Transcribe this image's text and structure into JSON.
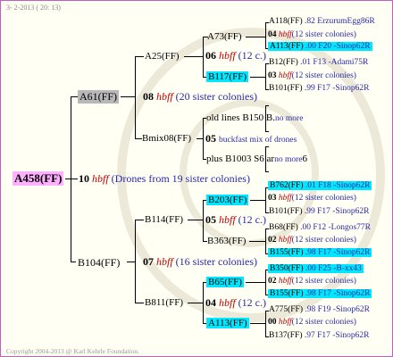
{
  "header": "3- 2-2013 ( 20: 13)",
  "footer": "Copyright 2004-2013 @ Karl Kehrle Foundation.",
  "root": {
    "name": "A458(FF)"
  },
  "gen1": [
    {
      "name": "A61(FF)",
      "num": "08",
      "hbff": "hbff",
      "note": "(20 sister colonies)"
    },
    {
      "num": "10",
      "hbff": "hbff",
      "note": "(Drones from 19 sister colonies)"
    },
    {
      "name": "B104(FF)",
      "num": "07",
      "hbff": "hbff",
      "note": "(16 sister colonies)"
    }
  ],
  "gen2": [
    {
      "name": "A25(FF)",
      "num": "06",
      "hbff": "hbff",
      "note": "(12 c.)"
    },
    {
      "name": "Bmix08(FF)",
      "num": "05",
      "note": "buckfast mix of drones"
    },
    {
      "name": "B114(FF)",
      "num": "05",
      "hbff": "hbff",
      "note": "(12 c.)"
    },
    {
      "name": "B811(FF)",
      "num": "04",
      "hbff": "hbff",
      "note": "(12 c.)"
    }
  ],
  "gen3": [
    {
      "name": "A73(FF)"
    },
    {
      "name": "B117(FF)"
    },
    {
      "name": "old lines B150 B.",
      "note": "no more"
    },
    {
      "name": "plus B1003 S6 ar",
      "note": "no more",
      "tail": "6"
    },
    {
      "name": "B203(FF)"
    },
    {
      "name": "B363(FF)"
    },
    {
      "name": "B65(FF)"
    },
    {
      "name": "A113(FF)"
    }
  ],
  "gen4": [
    {
      "name": "A118(FF)",
      "val": ".82",
      "note": "ErzurumEgg86R"
    },
    {
      "num": "04",
      "hbff": "hbff",
      "note": "(12 sister colonies)"
    },
    {
      "name": "A113(FF)",
      "val": ".00",
      "note": "F20 -Sinop62R"
    },
    {
      "name": "B12(FF)",
      "val": ".01",
      "note": "F13 -Adami75R"
    },
    {
      "num": "03",
      "hbff": "hbff",
      "note": "(12 sister colonies)"
    },
    {
      "name": "B101(FF)",
      "val": ".99",
      "note": "F17 -Sinop62R"
    },
    {
      "name": "B762(FF)",
      "val": ".01",
      "note": "F18 -Sinop62R"
    },
    {
      "num": "03",
      "hbff": "hbff",
      "note": "(12 sister colonies)"
    },
    {
      "name": "B101(FF)",
      "val": ".99",
      "note": "F17 -Sinop62R"
    },
    {
      "name": "B68(FF)",
      "val": ".00",
      "note": "F12 -Longos77R"
    },
    {
      "num": "02",
      "hbff": "hbff",
      "note": "(12 sister colonies)"
    },
    {
      "name": "B155(FF)",
      "val": ".98",
      "note": "F17 -Sinop62R"
    },
    {
      "name": "B350(FF)",
      "val": ".00",
      "note": "F25 -B-xx43"
    },
    {
      "num": "02",
      "hbff": "hbff",
      "note": "(12 sister colonies)"
    },
    {
      "name": "B155(FF)",
      "val": ".98",
      "note": "F17 -Sinop62R"
    },
    {
      "name": "A775(FF)",
      "val": ".98",
      "note": "F19 -Sinop62R"
    },
    {
      "num": "00",
      "hbff": "hbff",
      "note": "(12 sister colonies)"
    },
    {
      "name": "B137(FF)",
      "val": ".97",
      "note": "F17 -Sinop62R"
    }
  ]
}
